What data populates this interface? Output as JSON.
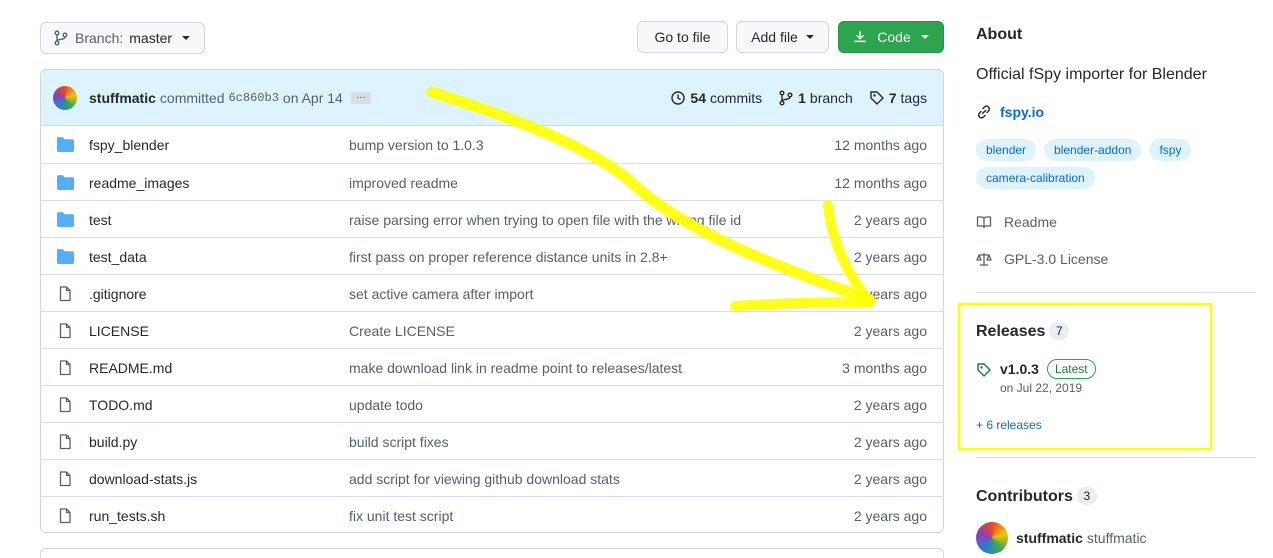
{
  "toolbar": {
    "branch_prefix": "Branch:",
    "branch_name": "master",
    "go_to_file": "Go to file",
    "add_file": "Add file",
    "code": "Code"
  },
  "commit": {
    "author": "stuffmatic",
    "verb": "committed",
    "sha": "6c860b3",
    "date": "on Apr 14",
    "ellipsis": "…",
    "commits_count": "54",
    "commits_label": "commits",
    "branch_count": "1",
    "branch_label": "branch",
    "tags_count": "7",
    "tags_label": "tags"
  },
  "files": [
    {
      "type": "folder",
      "name": "fspy_blender",
      "message": "bump version to 1.0.3",
      "time": "12 months ago"
    },
    {
      "type": "folder",
      "name": "readme_images",
      "message": "improved readme",
      "time": "12 months ago"
    },
    {
      "type": "folder",
      "name": "test",
      "message": "raise parsing error when trying to open file with the wrong file id",
      "time": "2 years ago"
    },
    {
      "type": "folder",
      "name": "test_data",
      "message": "first pass on proper reference distance units in 2.8+",
      "time": "2 years ago"
    },
    {
      "type": "file",
      "name": ".gitignore",
      "message": "set active camera after import",
      "time": "2 years ago"
    },
    {
      "type": "file",
      "name": "LICENSE",
      "message": "Create LICENSE",
      "time": "2 years ago"
    },
    {
      "type": "file",
      "name": "README.md",
      "message": "make download link in readme point to releases/latest",
      "time": "3 months ago"
    },
    {
      "type": "file",
      "name": "TODO.md",
      "message": "update todo",
      "time": "2 years ago"
    },
    {
      "type": "file",
      "name": "build.py",
      "message": "build script fixes",
      "time": "2 years ago"
    },
    {
      "type": "file",
      "name": "download-stats.js",
      "message": "add script for viewing github download stats",
      "time": "2 years ago"
    },
    {
      "type": "file",
      "name": "run_tests.sh",
      "message": "fix unit test script",
      "time": "2 years ago"
    }
  ],
  "about": {
    "heading": "About",
    "description": "Official fSpy importer for Blender",
    "website": "fspy.io",
    "topics": [
      "blender",
      "blender-addon",
      "fspy",
      "camera-calibration"
    ],
    "readme": "Readme",
    "license": "GPL-3.0 License"
  },
  "releases": {
    "heading": "Releases",
    "count": "7",
    "latest_version": "v1.0.3",
    "latest_badge": "Latest",
    "latest_date": "on Jul 22, 2019",
    "more_link": "+ 6 releases"
  },
  "contributors": {
    "heading": "Contributors",
    "count": "3",
    "first_login": "stuffmatic",
    "first_name": "stuffmatic"
  },
  "colors": {
    "annotation_yellow": "#ffff00",
    "folder_blue": "#54aeff",
    "code_button_green": "#2da44e"
  }
}
